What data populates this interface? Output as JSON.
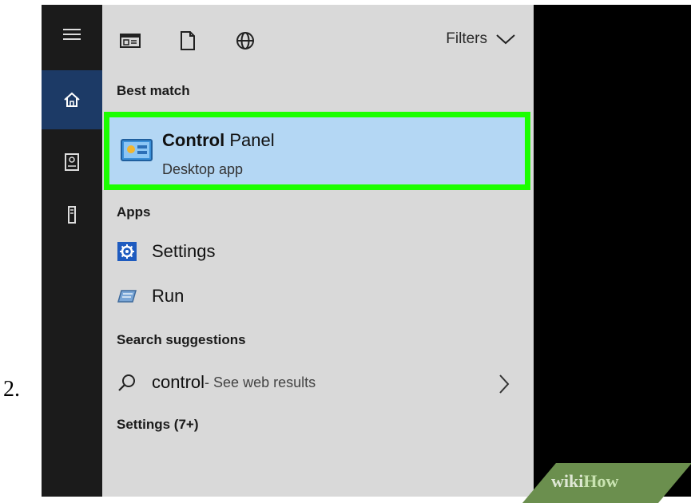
{
  "step_number": "2.",
  "toolbar": {
    "filters_label": "Filters"
  },
  "sections": {
    "best_match": "Best match",
    "apps": "Apps",
    "search_suggestions": "Search suggestions",
    "settings_more": "Settings (7+)"
  },
  "best_match": {
    "title_bold": "Control",
    "title_rest": " Panel",
    "subtitle": "Desktop app"
  },
  "apps": [
    {
      "label": "Settings",
      "icon": "gear-icon"
    },
    {
      "label": "Run",
      "icon": "run-icon"
    }
  ],
  "suggestion": {
    "term": "control",
    "suffix": " - See web results"
  },
  "watermark": {
    "part1": "wiki",
    "part2": "How"
  },
  "colors": {
    "highlight_border": "#1bff00",
    "selected_bg": "#b4d7f4",
    "active_rail": "#1c3a66"
  }
}
